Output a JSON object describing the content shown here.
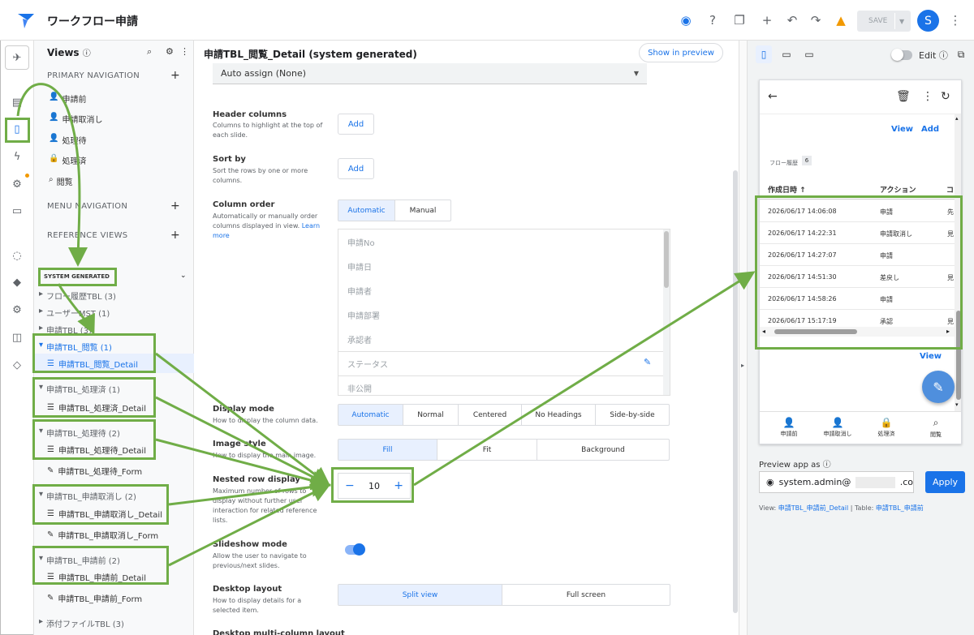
{
  "app": {
    "title": "ワークフロー申請",
    "save_label": "SAVE",
    "avatar_letter": "S"
  },
  "views": {
    "header": "Views",
    "primary_nav_label": "PRIMARY NAVIGATION",
    "primary_items": [
      "申請前",
      "申請取消し",
      "処理待",
      "処理済",
      "閲覧"
    ],
    "menu_nav_label": "MENU NAVIGATION",
    "reference_label": "REFERENCE VIEWS",
    "system_label": "SYSTEM GENERATED",
    "tree": [
      {
        "label": "フロー履歴TBL (3)"
      },
      {
        "label": "ユーザーMST (1)"
      },
      {
        "label": "申請TBL (3)"
      },
      {
        "label": "申請TBL_閲覧 (1)",
        "children": [
          "申請TBL_閲覧_Detail"
        ]
      },
      {
        "label": "申請TBL_処理済 (1)",
        "children": [
          "申請TBL_処理済_Detail"
        ]
      },
      {
        "label": "申請TBL_処理待 (2)",
        "children": [
          "申請TBL_処理待_Detail",
          "申請TBL_処理待_Form"
        ]
      },
      {
        "label": "申請TBL_申請取消し (2)",
        "children": [
          "申請TBL_申請取消し_Detail",
          "申請TBL_申請取消し_Form"
        ]
      },
      {
        "label": "申請TBL_申請前 (2)",
        "children": [
          "申請TBL_申請前_Detail",
          "申請TBL_申請前_Form"
        ]
      },
      {
        "label": "添付ファイルTBL (3)"
      }
    ]
  },
  "main": {
    "title": "申請TBL_閲覧_Detail (system generated)",
    "show_preview": "Show in preview",
    "auto_assign": "Auto assign (None)",
    "header_columns": {
      "title": "Header columns",
      "desc": "Columns to highlight at the top of each slide.",
      "button": "Add"
    },
    "sort_by": {
      "title": "Sort by",
      "desc": "Sort the rows by one or more columns.",
      "button": "Add"
    },
    "column_order": {
      "title": "Column order",
      "desc": "Automatically or manually order columns displayed in view.",
      "link": "Learn more",
      "options": [
        "Automatic",
        "Manual"
      ],
      "columns": [
        "申請No",
        "申請日",
        "申請者",
        "申請部署",
        "承認者",
        "ステータス",
        "非公開"
      ]
    },
    "display_mode": {
      "title": "Display mode",
      "desc": "How to display the column data.",
      "options": [
        "Automatic",
        "Normal",
        "Centered",
        "No Headings",
        "Side-by-side"
      ]
    },
    "image_style": {
      "title": "Image style",
      "desc": "How to display the main image.",
      "options": [
        "Fill",
        "Fit",
        "Background"
      ]
    },
    "nested_rows": {
      "title": "Nested row display",
      "desc": "Maximum number of rows to display without further user interaction for related reference lists.",
      "value": "10",
      "minus": "−",
      "plus": "+"
    },
    "slideshow": {
      "title": "Slideshow mode",
      "desc": "Allow the user to navigate to previous/next slides.",
      "enabled": true
    },
    "desktop_layout": {
      "title": "Desktop layout",
      "desc": "How to display details for a selected item.",
      "options": [
        "Split view",
        "Full screen"
      ]
    },
    "cut_title": "Desktop multi-column layout"
  },
  "preview": {
    "edit_label": "Edit",
    "view_links": [
      "View",
      "Add"
    ],
    "flow_label": "フロー履歴",
    "flow_count": "6",
    "table_headers": [
      "作成日時 ↑",
      "アクション",
      "コ"
    ],
    "rows": [
      {
        "date": "2026/06/17 14:06:08",
        "action": "申請",
        "c": "先"
      },
      {
        "date": "2026/06/17 14:22:31",
        "action": "申請取消し",
        "c": "見"
      },
      {
        "date": "2026/06/17 14:27:07",
        "action": "申請",
        "c": ""
      },
      {
        "date": "2026/06/17 14:51:30",
        "action": "差戻し",
        "c": "見"
      },
      {
        "date": "2026/06/17 14:58:26",
        "action": "申請",
        "c": ""
      },
      {
        "date": "2026/06/17 15:17:19",
        "action": "承認",
        "c": "見"
      }
    ],
    "view_below": "View",
    "bottom_nav": [
      "申請前",
      "申請取消し",
      "処理済",
      "閲覧"
    ],
    "preview_as_label": "Preview app as",
    "preview_as_value": "system.admin@",
    "preview_as_suffix": ".co",
    "apply": "Apply",
    "view_prefix": "View:",
    "view_name": "申請TBL_申請前_Detail",
    "table_prefix": "Table:",
    "table_name": "申請TBL_申請前"
  },
  "colors": {
    "accent": "#1a73e8",
    "annotation": "#70ad47"
  }
}
